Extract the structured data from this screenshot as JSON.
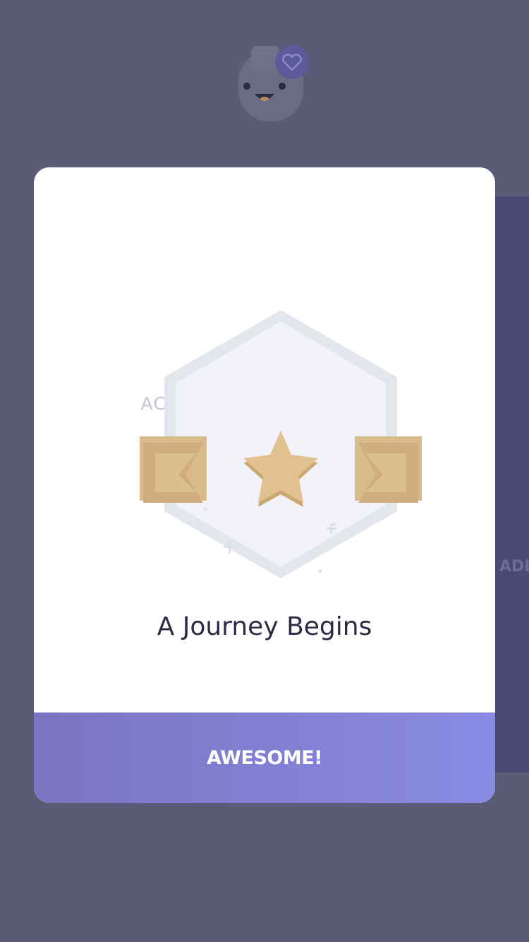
{
  "background": {
    "side_card_text": "ADD"
  },
  "modal": {
    "eyebrow": "ACHIEVEMENT UNLOCKED",
    "badge_icon": "star-badge-icon",
    "title": "A Journey Begins",
    "cta_label": "AWESOME!"
  },
  "colors": {
    "accent_start": "#7b74c2",
    "accent_end": "#8a8be3",
    "gold": "#e1c18f",
    "overlay": "#5a5b76"
  }
}
